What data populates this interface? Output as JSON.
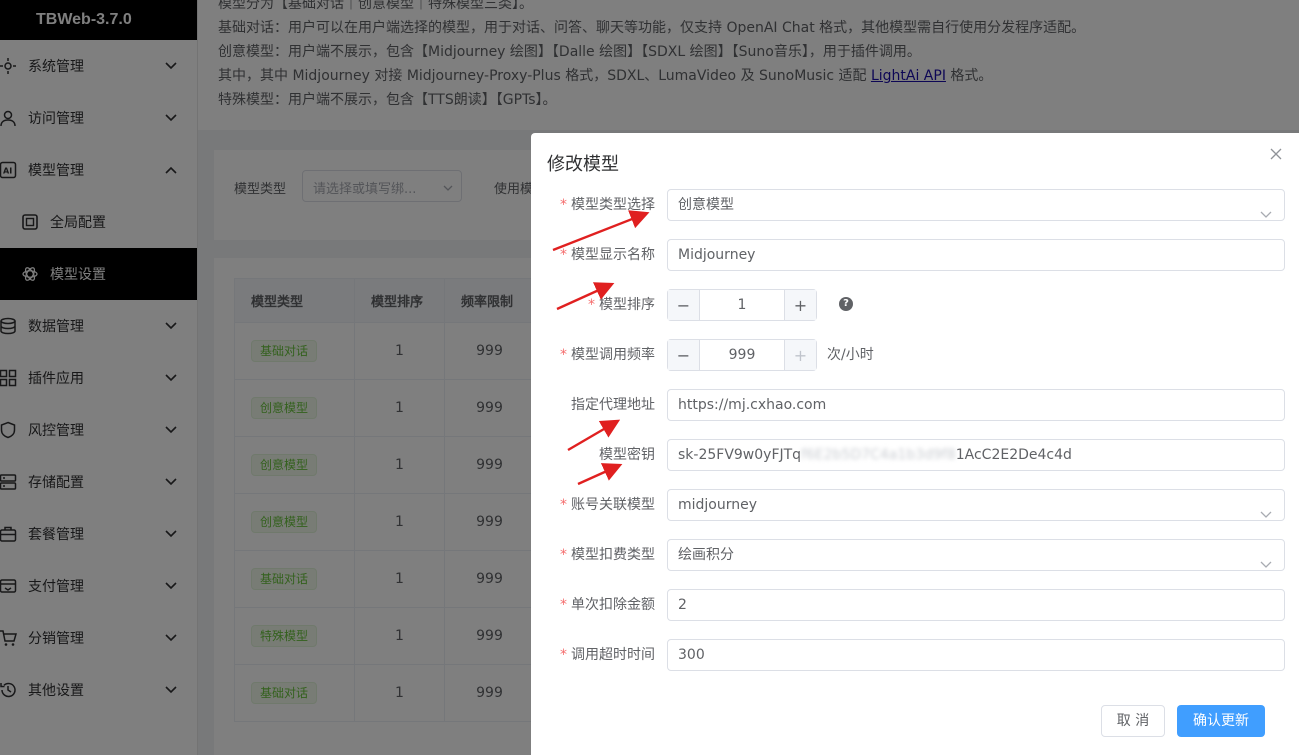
{
  "app": {
    "title": "TBWeb-3.7.0"
  },
  "sidebar": {
    "items": [
      {
        "label": "系统管理",
        "icon": "cog-icon"
      },
      {
        "label": "访问管理",
        "icon": "user-icon"
      },
      {
        "label": "模型管理",
        "icon": "ai-icon",
        "expanded": true
      },
      {
        "label": "数据管理",
        "icon": "database-icon"
      },
      {
        "label": "插件应用",
        "icon": "grid-icon"
      },
      {
        "label": "风控管理",
        "icon": "shield-icon"
      },
      {
        "label": "存储配置",
        "icon": "storage-icon"
      },
      {
        "label": "套餐管理",
        "icon": "briefcase-icon"
      },
      {
        "label": "支付管理",
        "icon": "payment-icon"
      },
      {
        "label": "分销管理",
        "icon": "cart-icon"
      },
      {
        "label": "其他设置",
        "icon": "history-icon"
      }
    ],
    "sub_items": [
      {
        "label": "全局配置",
        "icon": "config-icon"
      },
      {
        "label": "模型设置",
        "icon": "openai-icon",
        "active": true
      }
    ]
  },
  "notice": {
    "line0": "模型分为【基础对话｜创意模型｜特殊模型三类】。",
    "line1": "基础对话：用户可以在用户端选择的模型，用于对话、问答、聊天等功能，仅支持 OpenAI Chat 格式，其他模型需自行使用分发程序适配。",
    "line2": "创意模型：用户端不展示，包含【Midjourney 绘图】【Dalle 绘图】【SDXL 绘图】【Suno音乐】，用于插件调用。",
    "line3_prefix": "其中，其中 Midjourney 对接 Midjourney-Proxy-Plus 格式，SDXL、LumaVideo 及 SunoMusic 适配 ",
    "line3_link": "LightAi API",
    "line3_suffix": " 格式。",
    "line4": "特殊模型：用户端不展示，包含【TTS朗读】【GPTs】。"
  },
  "filter": {
    "type_label": "模型类型",
    "type_placeholder": "请选择或填写绑...",
    "use_label": "使用模"
  },
  "table": {
    "headers": [
      "模型类型",
      "模型排序",
      "频率限制"
    ],
    "rows": [
      {
        "type": "基础对话",
        "order": "1",
        "limit": "999"
      },
      {
        "type": "创意模型",
        "order": "1",
        "limit": "999"
      },
      {
        "type": "创意模型",
        "order": "1",
        "limit": "999"
      },
      {
        "type": "创意模型",
        "order": "1",
        "limit": "999"
      },
      {
        "type": "基础对话",
        "order": "1",
        "limit": "999"
      },
      {
        "type": "特殊模型",
        "order": "1",
        "limit": "999"
      },
      {
        "type": "基础对话",
        "order": "1",
        "limit": "999"
      }
    ]
  },
  "dialog": {
    "title": "修改模型",
    "fields": {
      "model_type": {
        "label": "模型类型选择",
        "value": "创意模型",
        "required": true
      },
      "display_name": {
        "label": "模型显示名称",
        "value": "Midjourney",
        "required": true
      },
      "order": {
        "label": "模型排序",
        "value": "1",
        "required": true
      },
      "rate": {
        "label": "模型调用频率",
        "value": "999",
        "suffix": "次/小时",
        "required": true
      },
      "proxy": {
        "label": "指定代理地址",
        "value": "https://mj.cxhao.com",
        "required": false
      },
      "key": {
        "label": "模型密钥",
        "value_visible_prefix": "sk-25FV9w0yFJTq",
        "value_blurred": "f6E2b5D7C4a1b3d9f8",
        "value_visible_suffix": "1AcC2E2De4c4d",
        "required": false
      },
      "account_model": {
        "label": "账号关联模型",
        "value": "midjourney",
        "required": true
      },
      "deduct_type": {
        "label": "模型扣费类型",
        "value": "绘画积分",
        "required": true
      },
      "deduct_amount": {
        "label": "单次扣除金额",
        "value": "2",
        "required": true
      },
      "timeout": {
        "label": "调用超时时间",
        "value": "300",
        "required": true
      }
    },
    "cancel_label": "取 消",
    "confirm_label": "确认更新",
    "help_glyph": "?",
    "required_mark": "*"
  },
  "colors": {
    "primary": "#409eff",
    "required": "#f56c6c",
    "tag_green": "#67c23a",
    "annotation_arrow": "#e02020"
  }
}
